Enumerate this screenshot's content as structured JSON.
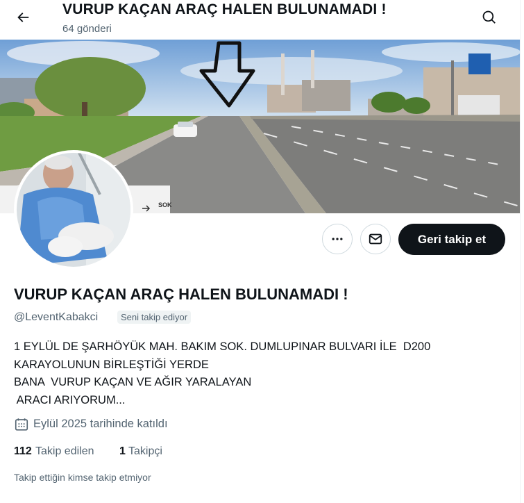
{
  "header": {
    "back_icon": "arrow-left-icon",
    "title": "VURUP KAÇAN ARAÇ HALEN BULUNAMADI !",
    "post_count": "64 gönderi",
    "search_icon": "search-icon"
  },
  "profile": {
    "display_name": "VURUP KAÇAN ARAÇ HALEN BULUNAMADI !",
    "handle": "@LeventKabakci",
    "follows_you_badge": "Seni takip ediyor",
    "bio": "1 EYLÜL DE ŞARHÖYÜK MAH. BAKIM SOK. DUMLUPINAR BULVARI İLE  D200\nKARAYOLUNUN BİRLEŞTİĞİ YERDE\nBANA  VURUP KAÇAN VE AĞIR YARALAYAN\n ARACI ARIYORUM...",
    "joined": "Eylül 2025 tarihinde katıldı",
    "following_count": "112",
    "following_label": "Takip edilen",
    "followers_count": "1",
    "followers_label": "Takipçi",
    "mutuals_note": "Takip ettiğin kimse takip etmiyor"
  },
  "actions": {
    "more_icon": "more-horizontal-icon",
    "message_icon": "envelope-icon",
    "follow_back_label": "Geri takip et"
  },
  "banner": {
    "sign_text": "SOK"
  },
  "colors": {
    "primary_text": "#0f1419",
    "secondary_text": "#536471",
    "button_dark": "#0f1419",
    "border": "#cfd9de"
  }
}
